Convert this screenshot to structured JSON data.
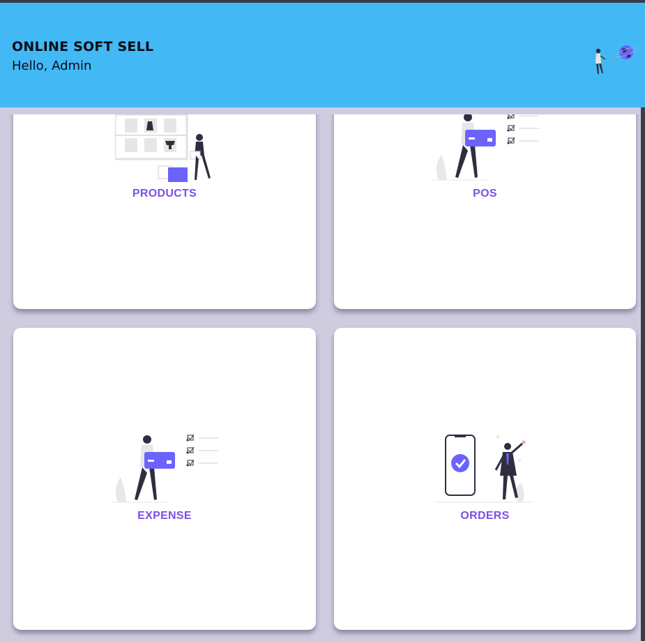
{
  "header": {
    "title": "ONLINE SOFT SELL",
    "greeting": "Hello, Admin",
    "background": "#42b9f5",
    "illustration_icon": "person-with-globe-icon"
  },
  "tiles": [
    {
      "label": "PRODUCTS",
      "icon": "product-shelf-illustration"
    },
    {
      "label": "POS",
      "icon": "payment-card-checklist-illustration"
    },
    {
      "label": "EXPENSE",
      "icon": "payment-card-checklist-illustration"
    },
    {
      "label": "ORDERS",
      "icon": "phone-order-confirmed-illustration"
    }
  ],
  "colors": {
    "accent": "#7b4fe8",
    "illustration_purple": "#6c63ff",
    "background": "#cfcce0"
  }
}
